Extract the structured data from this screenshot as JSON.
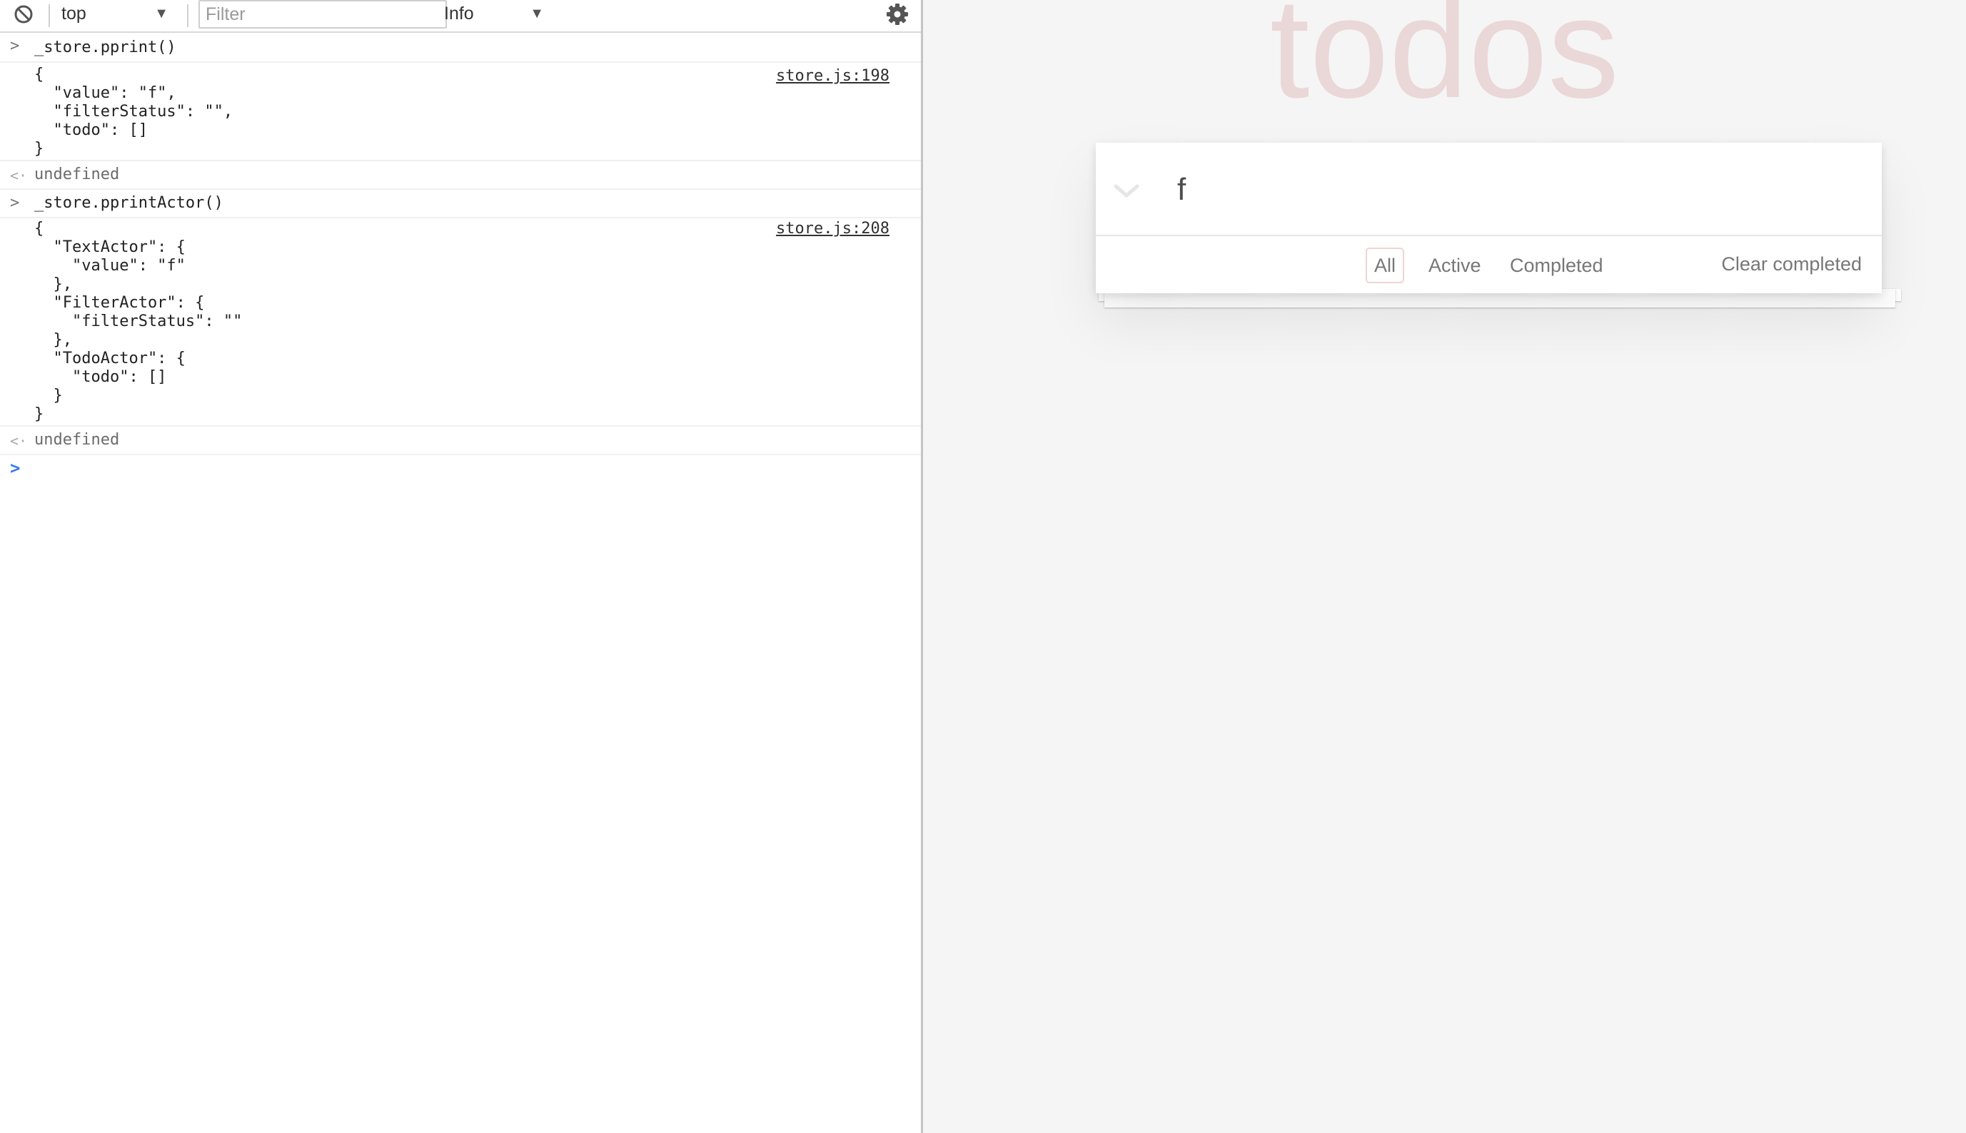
{
  "devtools": {
    "toolbar": {
      "context": "top",
      "filter_placeholder": "Filter",
      "level": "Info"
    },
    "console": {
      "entries": [
        {
          "command": "_store.pprint()",
          "output": "{\n  \"value\": \"f\",\n  \"filterStatus\": \"\",\n  \"todo\": []\n}",
          "source": "store.js:198",
          "result": "undefined"
        },
        {
          "command": "_store.pprintActor()",
          "output": "{\n  \"TextActor\": {\n    \"value\": \"f\"\n  },\n  \"FilterActor\": {\n    \"filterStatus\": \"\"\n  },\n  \"TodoActor\": {\n    \"todo\": []\n  }\n}",
          "source": "store.js:208",
          "result": "undefined"
        }
      ],
      "input_value": ""
    }
  },
  "app": {
    "title": "todos",
    "new_todo_value": "f",
    "filters": [
      "All",
      "Active",
      "Completed"
    ],
    "selected_filter": "All",
    "clear_completed": "Clear completed"
  },
  "colors": {
    "title": "#efd5d5",
    "prompt_accent": "#367cf1",
    "selected_filter_border": "#efd5d5"
  }
}
